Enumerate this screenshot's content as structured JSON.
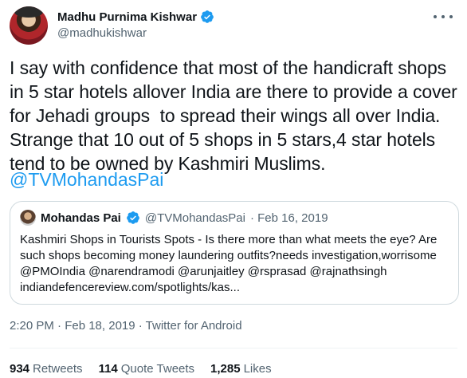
{
  "author": {
    "display_name": "Madhu Purnima Kishwar",
    "handle": "@madhukishwar"
  },
  "tweet": {
    "text": "I say with confidence that most of the handicraft shops\nin 5 star hotels allover India are there to provide a cover\nfor Jehadi groups  to spread their wings all over India.\nStrange that 10 out of 5 shops in 5 stars,4 star hotels\ntend to be owned by Kashmiri Muslims.",
    "mention": "@TVMohandasPai",
    "timestamp": "2:20 PM · Feb 18, 2019 · Twitter for Android"
  },
  "quoted": {
    "display_name": "Mohandas Pai",
    "handle": "@TVMohandasPai",
    "date": "· Feb 16, 2019",
    "text": "Kashmiri Shops in Tourists Spots - Is there more than what meets the eye? Are\nsuch shops becoming money laundering outfits?needs investigation,worrisome\n@PMOIndia @narendramodi @arunjaitley @rsprasad @rajnathsingh\nindiandefencereview.com/spotlights/kas..."
  },
  "stats": {
    "retweets_count": "934",
    "retweets_label": "Retweets",
    "quote_count": "114",
    "quote_label": "Quote Tweets",
    "likes_count": "1,285",
    "likes_label": "Likes"
  },
  "colors": {
    "accent": "#1d9bf0",
    "text": "#0f1419",
    "muted": "#536471"
  }
}
